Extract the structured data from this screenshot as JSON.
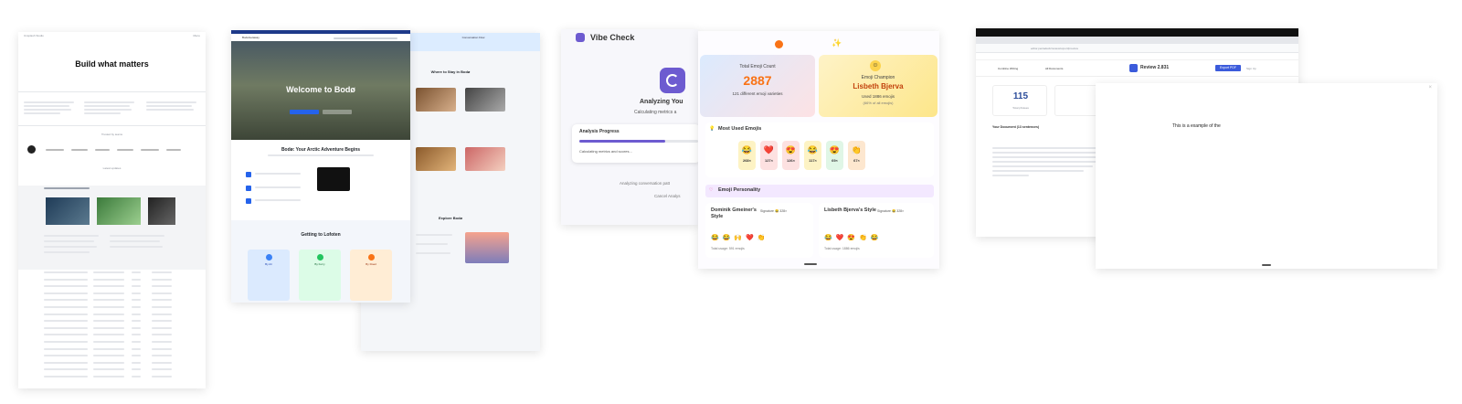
{
  "panel1": {
    "topbar_left": "Unsplash Studio",
    "topbar_right": "Menu",
    "headline": "Build what matters",
    "section_label": "Trusted by teams",
    "table_label": "Latest updates"
  },
  "panel2": {
    "nav_brand": "BodeGetaway",
    "hero_title": "Welcome to Bodø",
    "section1_title": "Bodø: Your Arctic Adventure Begins",
    "section2_title": "Getting to Lofoten",
    "plan_1": "By Air",
    "plan_2": "By Ferry",
    "plan_3": "By Road",
    "side_header": "Conversation Flow",
    "stay_title": "Where to Stay in Bodø",
    "explore_title": "Explore Bodø"
  },
  "panel3": {
    "app_title": "Vibe Check",
    "analyzing": "Analyzing You",
    "analyzing_sub": "Calculating metrics a",
    "progress_label": "Analysis Progress",
    "progress_fraction": 0.72,
    "progress_status": "Calculating metrics and scores...",
    "footer_text": "Analyzing conversation patt",
    "cancel": "Cancel Analys",
    "total_label": "Total Emoji Count",
    "total_value": "2887",
    "total_sub": "121 different emoji varieties",
    "champion_label": "Emoji Champion",
    "champion_name": "Lisbeth Bjerva",
    "champion_sub": "Used 1886 emojis",
    "champion_sub2": "(66% of all emojis)",
    "most_used_title": "Most Used Emojis",
    "emojis": [
      {
        "icon": "😂",
        "count": "268×",
        "bg": "#fdf3c4"
      },
      {
        "icon": "❤️",
        "count": "127×",
        "bg": "#fde1e1"
      },
      {
        "icon": "😍",
        "count": "126×",
        "bg": "#fde1e1"
      },
      {
        "icon": "😂",
        "count": "117×",
        "bg": "#fdf3c4"
      },
      {
        "icon": "😍",
        "count": "69×",
        "bg": "#e0f6e6"
      },
      {
        "icon": "👏",
        "count": "67×",
        "bg": "#fde7cf"
      }
    ],
    "personality_title": "Emoji Personality",
    "person1": "Dominik Gmeiner's Style",
    "person1_sig": "Signature 😂 328×",
    "person1_total": "Total usage: 591 emojis",
    "person2": "Lisbeth Bjerva's Style",
    "person2_sig": "Signature 😂 328×",
    "person2_total": "Total usage: 1886 emojis"
  },
  "panel4": {
    "stat_value": "115",
    "stat_label": "Total phrases",
    "section": "Your Document (13 sentences)",
    "modal_text": "This is a example of the",
    "review_title": "Review 2.831",
    "export_button": "Export PDF",
    "tab1": "Combine Writing",
    "tab2": "All Documents",
    "sign": "Sign Up",
    "address": "editor.pentadeck/review/export/preview"
  }
}
